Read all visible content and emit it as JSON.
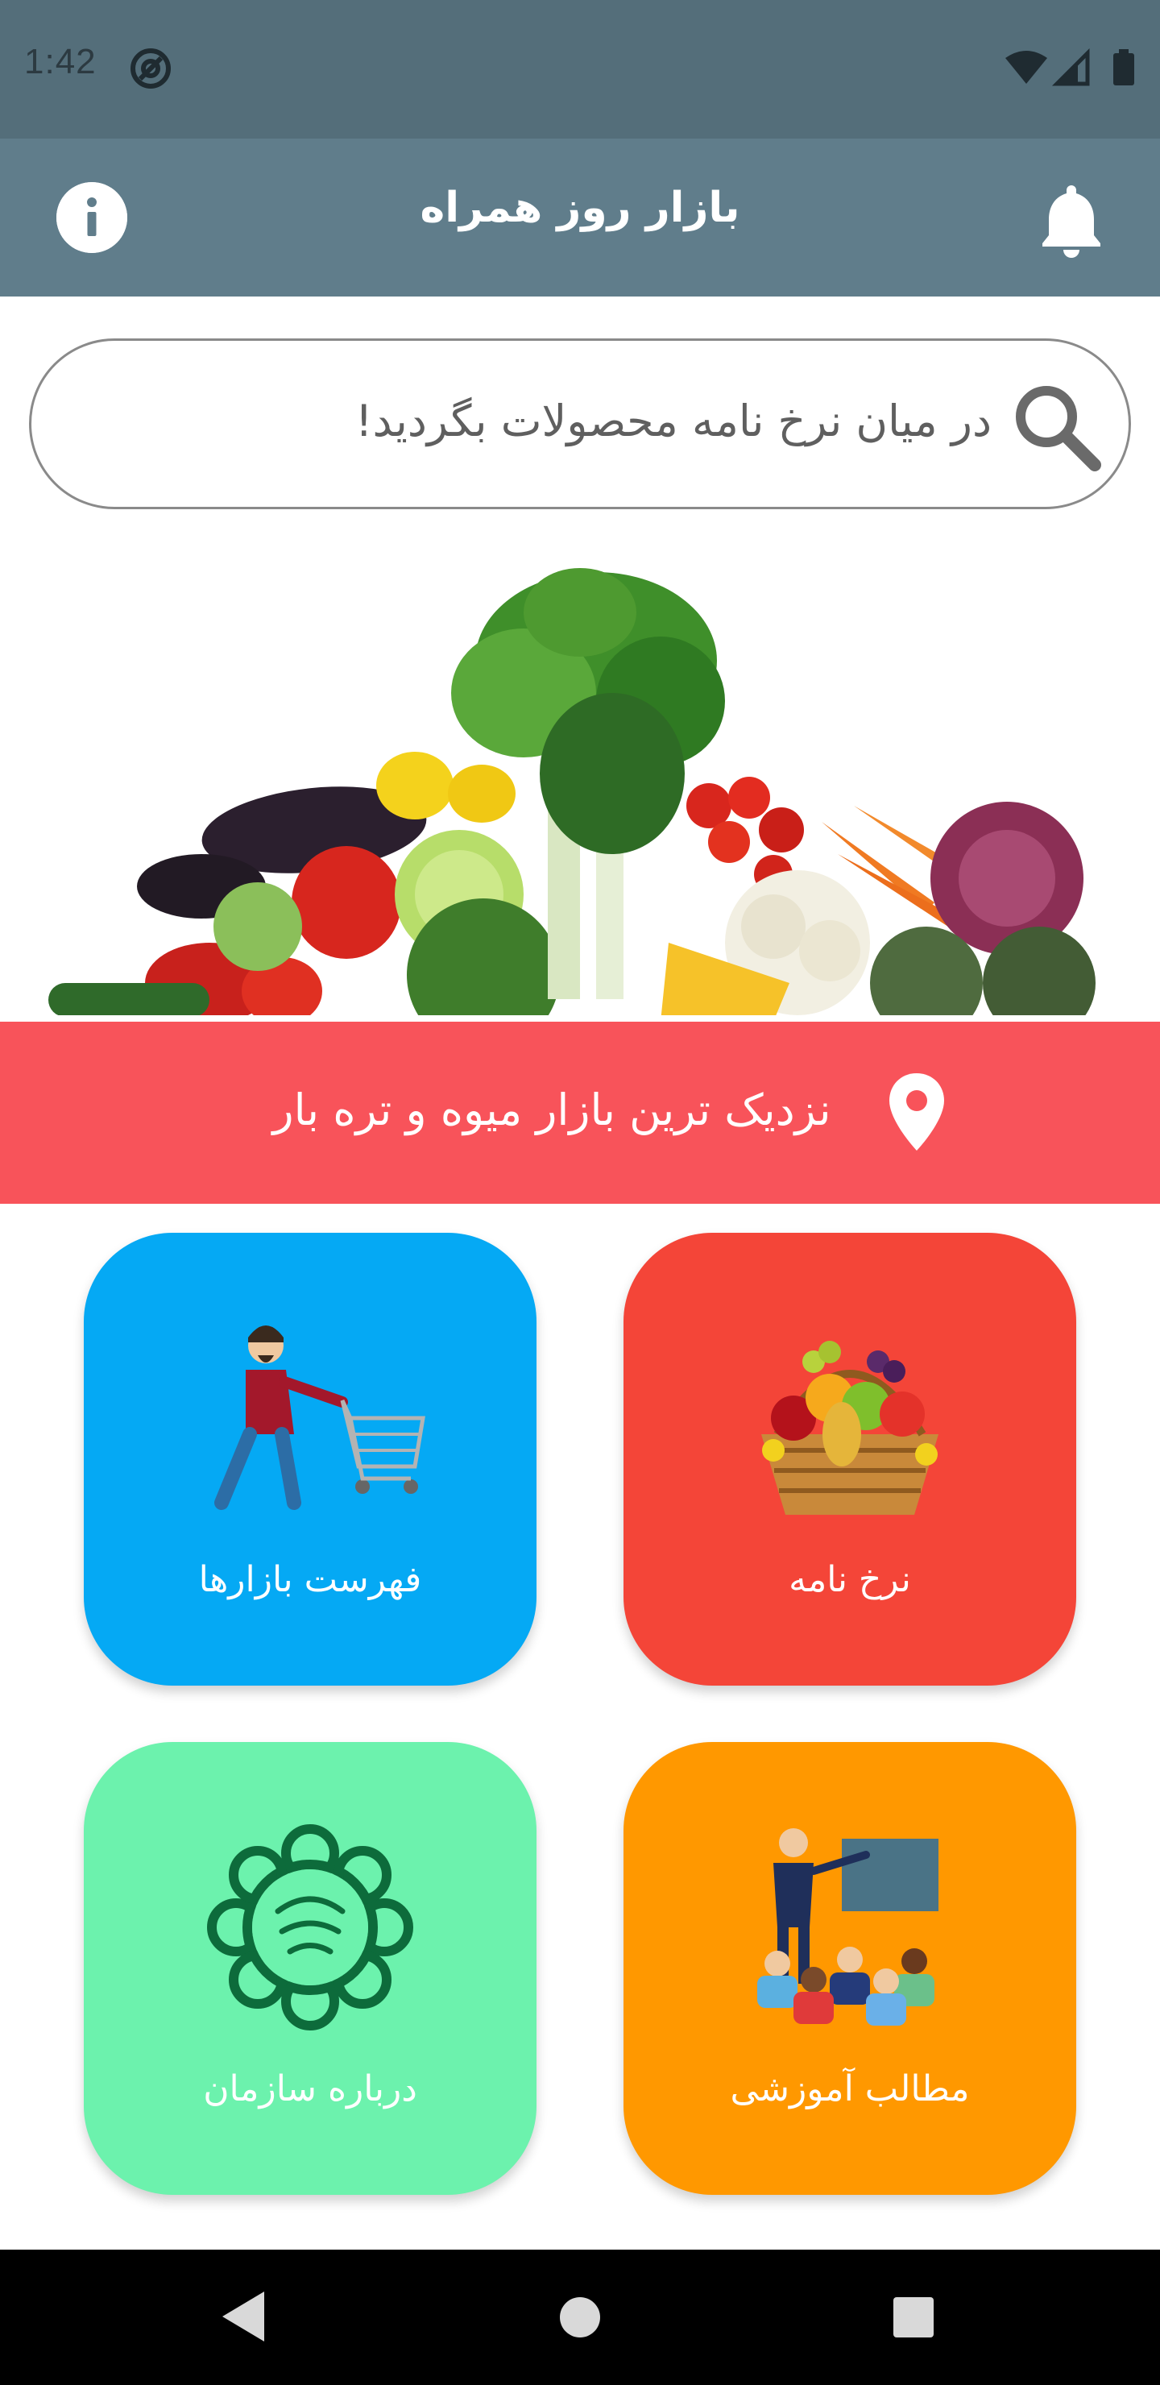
{
  "status_bar": {
    "time": "1:42",
    "icons": [
      "at-sign-icon",
      "wifi-icon",
      "signal-icon",
      "battery-icon"
    ]
  },
  "app_bar": {
    "title": "بازار روز همراه",
    "left_icon": "info-icon",
    "right_icon": "bell-icon"
  },
  "search": {
    "placeholder": "در میان نرخ نامه محصولات بگردید!",
    "icon": "search-icon"
  },
  "hero": {
    "image": "vegetables-pile"
  },
  "nearest_market": {
    "label": "نزدیک ترین بازار میوه و تره بار",
    "icon": "location-pin-icon",
    "color": "#f8535a"
  },
  "tiles": [
    {
      "label": "نرخ نامه",
      "color": "#f44538",
      "icon": "fruit-basket-icon"
    },
    {
      "label": "فهرست بازارها",
      "color": "#05a9f4",
      "icon": "shopping-cart-man-icon"
    },
    {
      "label": "مطالب آموزشی",
      "color": "#ff9800",
      "icon": "classroom-teacher-icon"
    },
    {
      "label": "درباره سازمان",
      "color": "#6cf2ad",
      "icon": "tehran-municipality-logo"
    }
  ],
  "nav_bar": {
    "buttons": [
      "back-icon",
      "home-icon",
      "recents-icon"
    ]
  },
  "colors": {
    "status_bar": "#546e7a",
    "app_bar": "#607d8b",
    "nav_bar": "#000000"
  }
}
